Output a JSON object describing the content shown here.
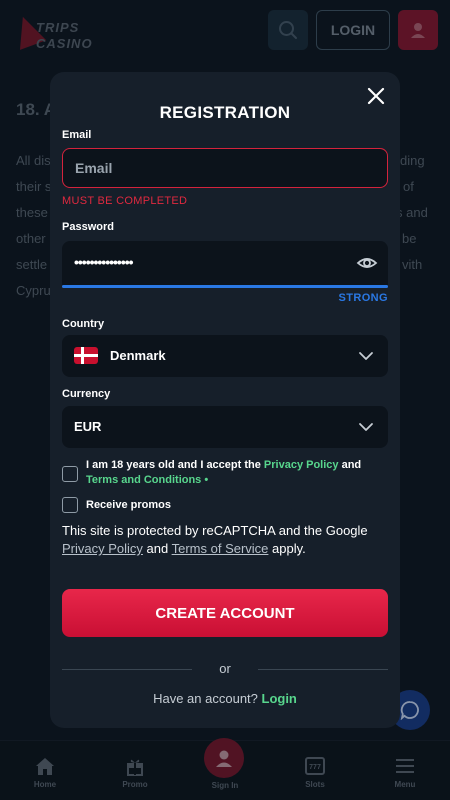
{
  "brand": {
    "line1": "TRIPS",
    "line2": "CASINO"
  },
  "header": {
    "login_label": "LOGIN"
  },
  "background": {
    "heading": "18. A",
    "lines": [
      "All dis",
      "their s",
      "these",
      "other",
      "settle",
      "Cypru"
    ],
    "right_fragments": [
      "ding",
      "of",
      "s and",
      "be",
      "vith"
    ]
  },
  "modal": {
    "title": "REGISTRATION",
    "email": {
      "label": "Email",
      "placeholder": "Email",
      "value": "",
      "error": "MUST BE COMPLETED"
    },
    "password": {
      "label": "Password",
      "value": "•••••••••••••••",
      "strength": "STRONG",
      "strength_fill": 1.0
    },
    "country": {
      "label": "Country",
      "value": "Denmark"
    },
    "currency": {
      "label": "Currency",
      "value": "EUR"
    },
    "age_check": {
      "checked": false,
      "text_pre": "I am 18 years old and I accept the ",
      "privacy_link": "Privacy Policy",
      "text_mid": " and",
      "terms_link": "Terms and Conditions",
      "required_mark": " •"
    },
    "promos_check": {
      "checked": false,
      "label": "Receive promos"
    },
    "recaptcha": {
      "text_pre": "This site is protected by reCAPTCHA and the Google",
      "privacy": "Privacy Policy",
      "and": " and ",
      "terms": "Terms of Service",
      "apply": " apply."
    },
    "create_button": "CREATE ACCOUNT",
    "or_label": "or",
    "have_account": "Have an account? ",
    "login_link": "Login"
  },
  "bottom_nav": [
    {
      "label": "Home",
      "icon": "home-icon"
    },
    {
      "label": "Promo",
      "icon": "gift-icon"
    },
    {
      "label": "Sign In",
      "icon": "user-icon"
    },
    {
      "label": "Slots",
      "icon": "slots-icon"
    },
    {
      "label": "Menu",
      "icon": "menu-icon"
    }
  ],
  "colors": {
    "accent": "#e0213f",
    "link": "#58d68d",
    "strength": "#2a78e4",
    "modal_bg": "#161f2a",
    "page_bg": "#0f1a24"
  }
}
